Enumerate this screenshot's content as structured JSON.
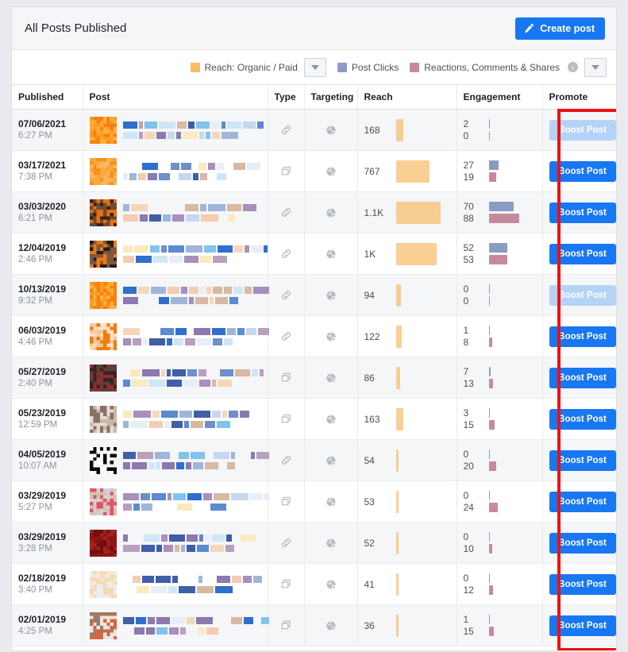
{
  "header": {
    "title": "All Posts Published",
    "create_post_label": "Create post",
    "pencil_icon": "pencil-icon"
  },
  "legend": {
    "items": [
      {
        "label": "Reach: Organic / Paid",
        "color": "#f7bd6b",
        "has_caret": true
      },
      {
        "label": "Post Clicks",
        "color": "#8a9bc4",
        "has_caret": false
      },
      {
        "label": "Reactions, Comments & Shares",
        "color": "#c68aa0",
        "has_caret": false,
        "info": "i"
      }
    ],
    "trailing_caret": "chevron-down-icon"
  },
  "table": {
    "columns": [
      "Published",
      "Post",
      "Type",
      "Targeting",
      "Reach",
      "Engagement",
      "Promote"
    ],
    "boost_label": "Boost Post",
    "rows": [
      {
        "date": "07/06/2021",
        "time": "6:27 PM",
        "type": "link",
        "targeting": "public",
        "reach": "168",
        "reach_w": 14,
        "clicks": "2",
        "reacts": "0",
        "clicks_w": 2,
        "reacts_w": 2,
        "boost": "disabled"
      },
      {
        "date": "03/17/2021",
        "time": "7:38 PM",
        "type": "photo",
        "targeting": "public",
        "reach": "767",
        "reach_w": 62,
        "clicks": "27",
        "reacts": "19",
        "clicks_w": 22,
        "reacts_w": 16,
        "boost": "active"
      },
      {
        "date": "03/03/2020",
        "time": "6:21 PM",
        "type": "link",
        "targeting": "public",
        "reach": "1.1K",
        "reach_w": 83,
        "clicks": "70",
        "reacts": "88",
        "clicks_w": 53,
        "reacts_w": 66,
        "boost": "active"
      },
      {
        "date": "12/04/2019",
        "time": "2:46 PM",
        "type": "link",
        "targeting": "public",
        "reach": "1K",
        "reach_w": 76,
        "clicks": "52",
        "reacts": "53",
        "clicks_w": 39,
        "reacts_w": 40,
        "boost": "active"
      },
      {
        "date": "10/13/2019",
        "time": "9:32 PM",
        "type": "link",
        "targeting": "public",
        "reach": "94",
        "reach_w": 9,
        "clicks": "0",
        "reacts": "0",
        "clicks_w": 2,
        "reacts_w": 2,
        "boost": "disabled"
      },
      {
        "date": "06/03/2019",
        "time": "4:46 PM",
        "type": "link",
        "targeting": "public",
        "reach": "122",
        "reach_w": 11,
        "clicks": "1",
        "reacts": "8",
        "clicks_w": 2,
        "reacts_w": 7,
        "boost": "active"
      },
      {
        "date": "05/27/2019",
        "time": "2:40 PM",
        "type": "photo",
        "targeting": "public",
        "reach": "86",
        "reach_w": 8,
        "clicks": "7",
        "reacts": "13",
        "clicks_w": 5,
        "reacts_w": 10,
        "boost": "active"
      },
      {
        "date": "05/23/2019",
        "time": "12:59 PM",
        "type": "photo",
        "targeting": "public",
        "reach": "163",
        "reach_w": 14,
        "clicks": "3",
        "reacts": "15",
        "clicks_w": 2,
        "reacts_w": 12,
        "boost": "active"
      },
      {
        "date": "04/05/2019",
        "time": "10:07 AM",
        "type": "link",
        "targeting": "public",
        "reach": "54",
        "reach_w": 5,
        "clicks": "0",
        "reacts": "20",
        "clicks_w": 2,
        "reacts_w": 16,
        "boost": "active"
      },
      {
        "date": "03/29/2019",
        "time": "5:27 PM",
        "type": "photo",
        "targeting": "public",
        "reach": "53",
        "reach_w": 5,
        "clicks": "0",
        "reacts": "24",
        "clicks_w": 2,
        "reacts_w": 19,
        "boost": "active"
      },
      {
        "date": "03/29/2019",
        "time": "3:28 PM",
        "type": "link",
        "targeting": "public",
        "reach": "52",
        "reach_w": 5,
        "clicks": "0",
        "reacts": "10",
        "clicks_w": 2,
        "reacts_w": 8,
        "boost": "active"
      },
      {
        "date": "02/18/2019",
        "time": "3:40 PM",
        "type": "photo",
        "targeting": "public",
        "reach": "41",
        "reach_w": 5,
        "clicks": "0",
        "reacts": "12",
        "clicks_w": 2,
        "reacts_w": 9,
        "boost": "active"
      },
      {
        "date": "02/01/2019",
        "time": "4:25 PM",
        "type": "photo",
        "targeting": "public",
        "reach": "36",
        "reach_w": 5,
        "clicks": "1",
        "reacts": "15",
        "clicks_w": 2,
        "reacts_w": 11,
        "boost": "active"
      }
    ]
  },
  "annotation": {
    "highlight_color": "#ee1111",
    "target_column": "Promote"
  }
}
